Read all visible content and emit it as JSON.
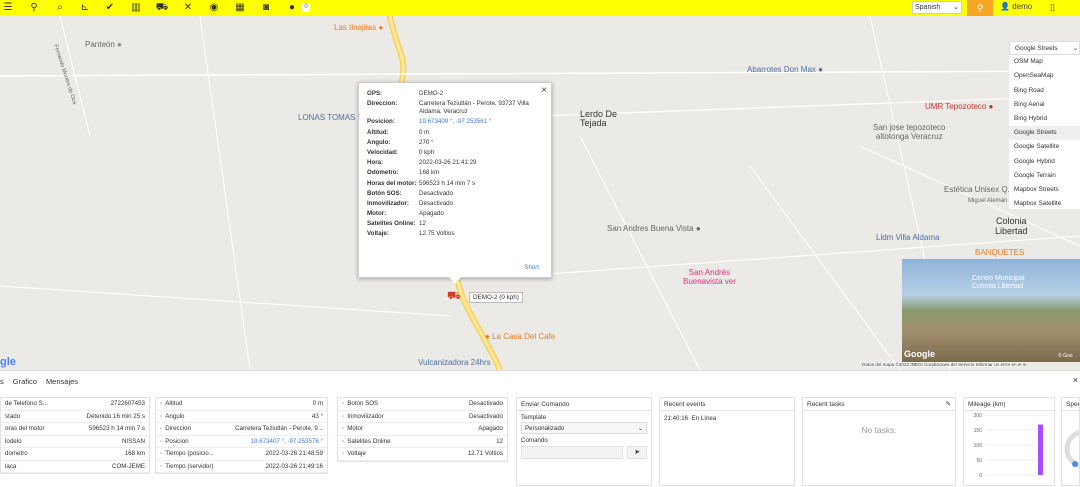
{
  "topbar": {
    "icons": [
      "menu-icon",
      "map-pin-icon",
      "search-icon",
      "chart-icon",
      "check-icon",
      "book-icon",
      "car-icon",
      "tools-icon",
      "coins-icon",
      "calendar-icon",
      "camera-icon",
      "chat-icon"
    ],
    "badge": "0",
    "language": "Spanish",
    "user": "demo",
    "background_color": "#ffff00",
    "accent_color": "#f5a623"
  },
  "map": {
    "labels": {
      "panteon": "Panteón",
      "tinajitas": "Las tinajitas",
      "fernando_montes": "Fernando Montes de Oca",
      "abarrotes": "Abarrotes Don Max",
      "lonas": "LONAS TOMAS",
      "lerdo": "Lerdo De\nTejada",
      "umr": "UMR Tepozoteco",
      "san_jose": "San jose tepozoteco\naltotonga Veracruz",
      "estetica": "Estética Unisex Q...",
      "miguel_aleman": "Miguel Alemán",
      "colonia": "Colonia\nLibertad",
      "villa_aldama": "Lldm Villa Aldama",
      "banquetes": "BANQUETES",
      "buena_vista": "San Andres Buena Vista",
      "san_andres": "San Andrés\nBuenavista ver",
      "casa_cafe": "La Casa Del Cafe",
      "vulcanizadora": "Vulcanizadora 24hrs",
      "google": "gle",
      "attribution": "Datos del mapa ©2022 INEGI   Condiciones del Servicio   Informar un error en el m",
      "vehicle_tag": "DEMO-2 (0 kph)",
      "street_view_text": "Centro Municipal\nColonia Libertad",
      "street_view_google": "Google",
      "street_view_copy": "© Goo"
    },
    "layer_options": [
      "Google Streets",
      "OSM Map",
      "OpenSeaMap",
      "Bing Road",
      "Bing Aerial",
      "Bing Hybrid",
      "Google Streets",
      "Google Satellite",
      "Google Hybrid",
      "Google Terrain",
      "Mapbox Streets",
      "Mapbox Satellite"
    ],
    "layer_selected": "Google Streets"
  },
  "popup": {
    "rows": [
      {
        "k": "GPS:",
        "v": "DEMO-2"
      },
      {
        "k": "Direccion:",
        "v": "Carretera Teziutlán - Perote, 93737 Villa Aldama, Veracruz"
      },
      {
        "k": "Posicion:",
        "v": "19.673409 °, -97.253561 °"
      },
      {
        "k": "Altitud:",
        "v": "0 m"
      },
      {
        "k": "Angulo:",
        "v": "270 °"
      },
      {
        "k": "Velocidad:",
        "v": "0 kph"
      },
      {
        "k": "Hora:",
        "v": "2022-03-26 21:41:29"
      },
      {
        "k": "Odometro:",
        "v": "168 km"
      },
      {
        "k": "Horas del motor:",
        "v": "596523 h 14 min 7 s"
      },
      {
        "k": "Botón SOS:",
        "v": "Desactivado"
      },
      {
        "k": "Inmovilizador:",
        "v": "Desactivado"
      },
      {
        "k": "Motor:",
        "v": "Apagado"
      },
      {
        "k": "Satelites Online:",
        "v": "12"
      },
      {
        "k": "Voltaje:",
        "v": "12.75 Voltios"
      }
    ],
    "short": "Short",
    "close": "×"
  },
  "bottom": {
    "tabs": [
      "s",
      "Grafico",
      "Mensajes"
    ],
    "close": "×",
    "panel1": [
      {
        "k": "de Telefono S...",
        "v": "2722607453"
      },
      {
        "k": "stado",
        "v": "Detenido 16 min 25 s"
      },
      {
        "k": "oras del motor",
        "v": "596523 h 14 min 7 s"
      },
      {
        "k": "lodelo",
        "v": "NISSAN"
      },
      {
        "k": "dometro",
        "v": "168 km"
      },
      {
        "k": "laca",
        "v": "COM-JEME"
      }
    ],
    "panel2": [
      {
        "icon": "altitude-icon",
        "k": "Altitud",
        "v": "0 m"
      },
      {
        "icon": "angle-icon",
        "k": "Angulo",
        "v": "43 °"
      },
      {
        "icon": "address-icon",
        "k": "Direccion",
        "v": "Carretera Teziutlán - Perote, 9..."
      },
      {
        "icon": "position-icon",
        "k": "Posicion",
        "v": "19.673407 °, -97.253576 °"
      },
      {
        "icon": "clock-icon",
        "k": "Tiempo (posicio...",
        "v": "2022-03-26 21:48:59"
      },
      {
        "icon": "clock-icon",
        "k": "Tiempo (servidor)",
        "v": "2022-03-26 21:49:16"
      }
    ],
    "panel3": [
      {
        "icon": "sos-icon",
        "k": "Botón SOS",
        "v": "Desactivado"
      },
      {
        "icon": "immobilizer-icon",
        "k": "Inmovilizador",
        "v": "Desactivado"
      },
      {
        "icon": "engine-icon",
        "k": "Motor",
        "v": "Apagado"
      },
      {
        "icon": "satellite-icon",
        "k": "Satelites Online",
        "v": "12"
      },
      {
        "icon": "battery-icon",
        "k": "Voltaje",
        "v": "12.71 Voltios"
      }
    ],
    "command": {
      "title": "Enviar Comando",
      "template_label": "Template",
      "template_value": "Personalizado",
      "command_label": "Comando",
      "command_value": ""
    },
    "events": {
      "title": "Recent events",
      "time": "21:40:16",
      "text": "En Línea"
    },
    "tasks": {
      "title": "Recent tasks",
      "empty": "No tasks."
    },
    "mileage": {
      "title": "Mileage (km)"
    },
    "speed": {
      "title": "Speed"
    }
  },
  "chart_data": {
    "type": "bar",
    "title": "Mileage (km)",
    "categories": [
      ""
    ],
    "values": [
      168
    ],
    "ylim": [
      0,
      200
    ],
    "yticks": [
      200,
      150,
      100,
      50,
      0
    ],
    "grid": true,
    "bar_color": "#a64dff"
  }
}
